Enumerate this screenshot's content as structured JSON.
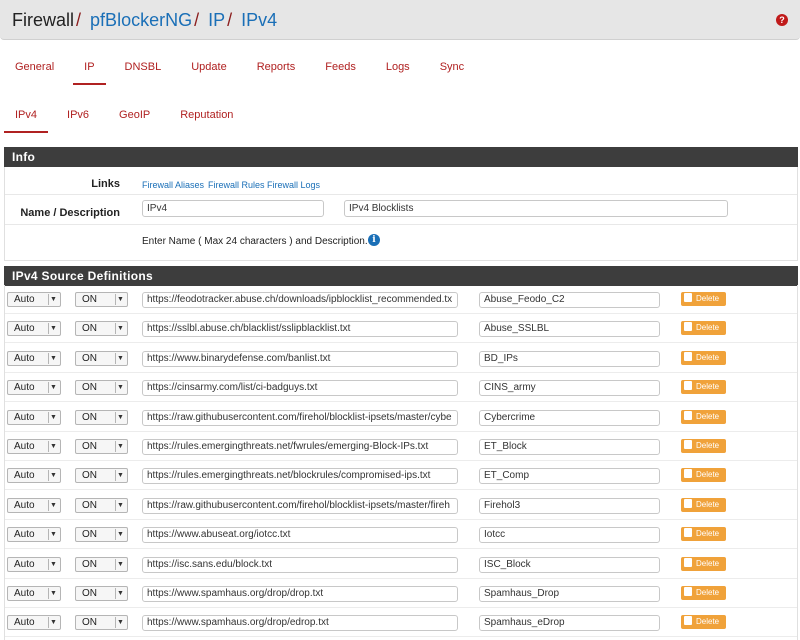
{
  "breadcrumb": {
    "first": "Firewall",
    "items": [
      "pfBlockerNG",
      "IP",
      "IPv4"
    ]
  },
  "help_icon_glyph": "?",
  "tabs_main": [
    {
      "label": "General",
      "active": false
    },
    {
      "label": "IP",
      "active": true
    },
    {
      "label": "DNSBL",
      "active": false
    },
    {
      "label": "Update",
      "active": false
    },
    {
      "label": "Reports",
      "active": false
    },
    {
      "label": "Feeds",
      "active": false
    },
    {
      "label": "Logs",
      "active": false
    },
    {
      "label": "Sync",
      "active": false
    }
  ],
  "tabs_sub": [
    {
      "label": "IPv4",
      "active": true
    },
    {
      "label": "IPv6",
      "active": false
    },
    {
      "label": "GeoIP",
      "active": false
    },
    {
      "label": "Reputation",
      "active": false
    }
  ],
  "info": {
    "title": "Info",
    "links_label": "Links",
    "links": [
      "Firewall Aliases",
      "Firewall Rules",
      "Firewall Logs"
    ],
    "name_label": "Name / Description",
    "name_value": "IPv4",
    "description_value": "IPv4 Blocklists",
    "hint": "Enter Name ( Max 24 characters ) and Description.",
    "info_icon_glyph": "i"
  },
  "sources": {
    "title": "IPv4 Source Definitions",
    "delete_label": "Delete",
    "rows": [
      {
        "format": "Auto",
        "state": "ON",
        "url": "https://feodotracker.abuse.ch/downloads/ipblocklist_recommended.tx",
        "header": "Abuse_Feodo_C2"
      },
      {
        "format": "Auto",
        "state": "ON",
        "url": "https://sslbl.abuse.ch/blacklist/sslipblacklist.txt",
        "header": "Abuse_SSLBL"
      },
      {
        "format": "Auto",
        "state": "ON",
        "url": "https://www.binarydefense.com/banlist.txt",
        "header": "BD_IPs"
      },
      {
        "format": "Auto",
        "state": "ON",
        "url": "https://cinsarmy.com/list/ci-badguys.txt",
        "header": "CINS_army"
      },
      {
        "format": "Auto",
        "state": "ON",
        "url": "https://raw.githubusercontent.com/firehol/blocklist-ipsets/master/cybe",
        "header": "Cybercrime"
      },
      {
        "format": "Auto",
        "state": "ON",
        "url": "https://rules.emergingthreats.net/fwrules/emerging-Block-IPs.txt",
        "header": "ET_Block"
      },
      {
        "format": "Auto",
        "state": "ON",
        "url": "https://rules.emergingthreats.net/blockrules/compromised-ips.txt",
        "header": "ET_Comp"
      },
      {
        "format": "Auto",
        "state": "ON",
        "url": "https://raw.githubusercontent.com/firehol/blocklist-ipsets/master/fireh",
        "header": "Firehol3"
      },
      {
        "format": "Auto",
        "state": "ON",
        "url": "https://www.abuseat.org/iotcc.txt",
        "header": "Iotcc"
      },
      {
        "format": "Auto",
        "state": "ON",
        "url": "https://isc.sans.edu/block.txt",
        "header": "ISC_Block"
      },
      {
        "format": "Auto",
        "state": "ON",
        "url": "https://www.spamhaus.org/drop/drop.txt",
        "header": "Spamhaus_Drop"
      },
      {
        "format": "Auto",
        "state": "ON",
        "url": "https://www.spamhaus.org/drop/edrop.txt",
        "header": "Spamhaus_eDrop"
      }
    ]
  }
}
